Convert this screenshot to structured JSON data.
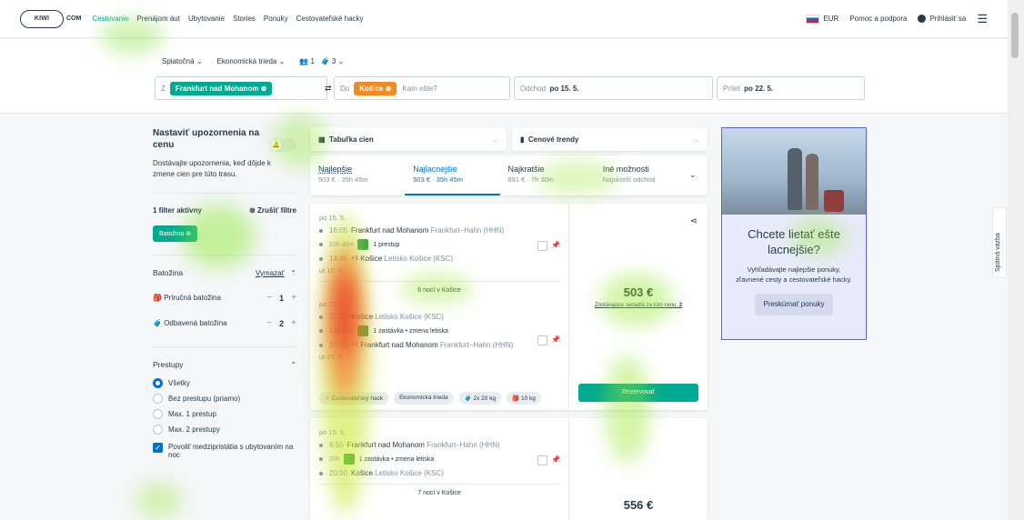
{
  "nav": {
    "logo_text": "KIWI",
    "logo_suffix": "COM",
    "links": [
      "Cestovanie",
      "Prenájom áut",
      "Ubytovanie",
      "Stories",
      "Ponuky",
      "Cestovateľské hacky"
    ],
    "currency": "EUR",
    "help": "Pomoc a podpora",
    "login": "Prihlásiť sa"
  },
  "search": {
    "trip_type": "Spiatočná",
    "cabin": "Ekonomická trieda",
    "adults": "1",
    "bags": "3",
    "from_label": "Z",
    "from_chip": "Frankfurt nad Mohanom",
    "to_label": "Do",
    "to_chip": "Košice",
    "to_placeholder": "Kam ešte?",
    "depart_label": "Odchod",
    "depart_value": "po 15. 5.",
    "return_label": "Prílet",
    "return_value": "po 22. 5."
  },
  "sidebar": {
    "alert_title": "Nastaviť upozornenia na cenu",
    "alert_desc": "Dostávajte upozornenia, keď dôjde k zmene cien pre túto trasu.",
    "filters_active": "1 filter aktívny",
    "clear_filters": "Zrušiť filtre",
    "active_tag": "Batožina",
    "baggage_title": "Batožina",
    "baggage_clear": "Vymazať",
    "cabin_bag": "Príručná batožina",
    "cabin_bag_count": "1",
    "checked_bag": "Odbavená batožina",
    "checked_bag_count": "2",
    "stops_title": "Prestupy",
    "stops": [
      "Všetky",
      "Bez prestupu (priamo)",
      "Max. 1 prestup",
      "Max. 2 prestupy"
    ],
    "overnight": "Povoliť medzipristátia s ubytovaním na noc"
  },
  "results": {
    "price_table": "Tabuľka cien",
    "price_trends": "Cenové trendy",
    "sort": [
      {
        "label": "Najlepšie",
        "sub": "503 € · 35h 45m"
      },
      {
        "label": "Najlacnejšie",
        "sub": "503 € · 35h 45m"
      },
      {
        "label": "Najkratšie",
        "sub": "891 € · 7h 30m"
      },
      {
        "label": "Iné možnosti",
        "sub": "Najskorší odchod"
      }
    ],
    "card1": {
      "out_date": "po 15. 5.",
      "out_dep_time": "16:05",
      "out_dep_place": "Frankfurt nad Mohanom",
      "out_dep_airport": "Frankfurt–Hahn (HHN)",
      "out_duration": "22h 40m",
      "out_stops": "1 prestup",
      "out_arr_time": "14:45",
      "out_arr_plus": "+1",
      "out_arr_place": "Košice",
      "out_arr_airport": "Letisko Košice (KSC)",
      "out_arr_date": "ut 16. 5.",
      "nights": "6 nocí v Košice",
      "ret_date": "po 22. 5.",
      "ret_dep_time": "21:25",
      "ret_dep_place": "Košice",
      "ret_dep_airport": "Letisko Košice (KSC)",
      "ret_duration": "13h 05m",
      "ret_stops": "1 zastávka • zmena letiska",
      "ret_arr_time": "10:30",
      "ret_arr_plus": "+1",
      "ret_arr_place": "Frankfurt nad Mohanom",
      "ret_arr_airport": "Frankfurt–Hahn (HHN)",
      "ret_arr_date": "ut 23. 5.",
      "price": "503 €",
      "seats_text": "Zostávajúce sedadlá za túto cenu:",
      "seats_count": "2",
      "reserve": "Rezervovať",
      "hack": "Cestovateľský hack",
      "cabin": "Ekonomická trieda",
      "checked": "2x 20 kg",
      "hand": "10 kg"
    },
    "card2": {
      "out_date": "po 15. 5.",
      "out_dep_time": "6:50",
      "out_dep_place": "Frankfurt nad Mohanom",
      "out_dep_airport": "Frankfurt–Hahn (HHN)",
      "out_duration": "20h",
      "out_stops": "1 zastávka • zmena letiska",
      "out_arr_time": "20:50",
      "out_arr_place": "Košice",
      "out_arr_airport": "Letisko Košice (KSC)",
      "nights": "7 nocí v Košice",
      "price": "556 €"
    }
  },
  "ad": {
    "title": "Chcete lietať ešte lacnejšie?",
    "text": "Vyhľadávajte najlepšie ponuky, zľavnené cesty a cestovateľské hacky.",
    "button": "Preskúmať ponuky"
  },
  "feedback": "Spätná väzba"
}
